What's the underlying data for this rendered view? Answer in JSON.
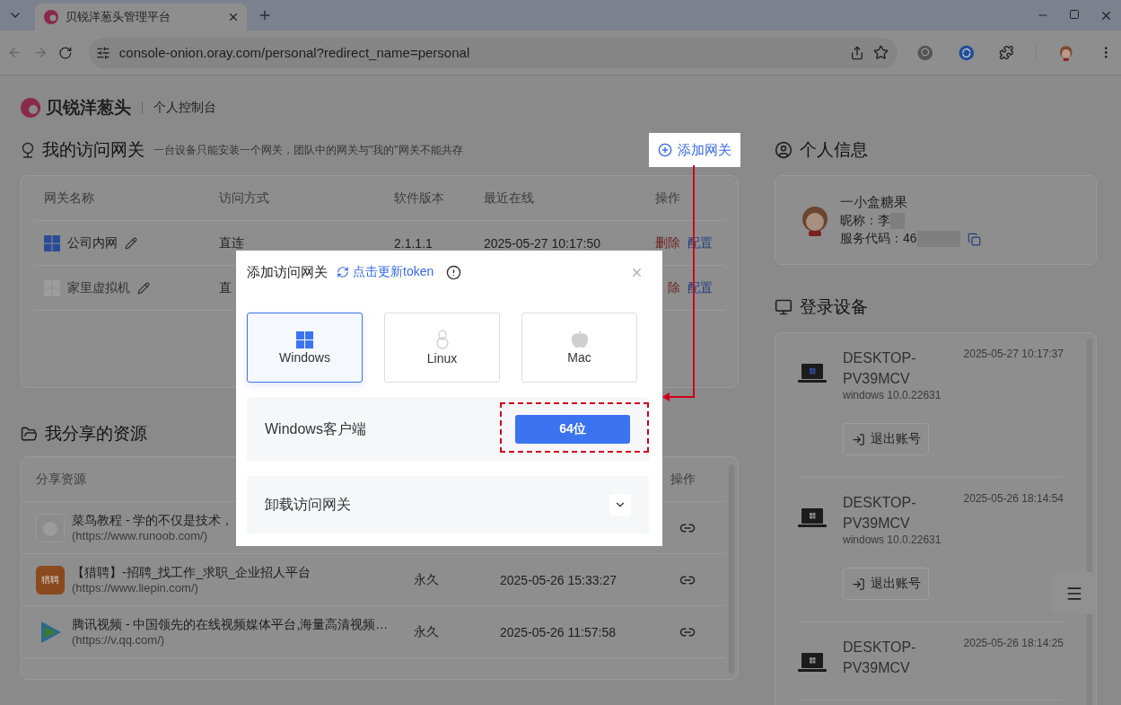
{
  "browser": {
    "tab_title": "贝锐洋葱头管理平台",
    "url": "console-onion.oray.com/personal?redirect_name=personal"
  },
  "header": {
    "brand": "贝锐洋葱头",
    "subtitle": "个人控制台"
  },
  "gateways": {
    "title": "我的访问网关",
    "hint": "一台设备只能安装一个网关，团队中的网关与\"我的\"网关不能共存",
    "add_button": "添加网关",
    "columns": [
      "网关名称",
      "访问方式",
      "软件版本",
      "最近在线",
      "操作"
    ],
    "rows": [
      {
        "name": "公司内网",
        "online": true,
        "access": "直连",
        "version": "2.1.1.1",
        "last_online": "2025-05-27 10:17:50",
        "delete": "删除",
        "configure": "配置"
      },
      {
        "name": "家里虚拟机",
        "online": false,
        "access": "直",
        "delete": "除",
        "configure": "配置"
      }
    ]
  },
  "shares": {
    "title": "我分享的资源",
    "columns": [
      "分享资源",
      "操作"
    ],
    "rows": [
      {
        "kind": "runoob",
        "title": "菜鸟教程 - 学的不仅是技术，",
        "url": "(https://www.runoob.com/)"
      },
      {
        "kind": "liepin",
        "icon_text": "猎聘",
        "title": "【猎聘】-招聘_找工作_求职_企业招人平台",
        "url": "(https://www.liepin.com/)",
        "validity": "永久",
        "time": "2025-05-26 15:33:27"
      },
      {
        "kind": "video",
        "title": "腾讯视频 - 中国领先的在线视频媒体平台,海量高清视频…",
        "url": "(https://v.qq.com/)",
        "validity": "永久",
        "time": "2025-05-26 11:57:58"
      }
    ]
  },
  "profile": {
    "title": "个人信息",
    "name": "一小盒糖果",
    "nickname": "昵称：李",
    "service_code": "服务代码：46"
  },
  "devices": {
    "title": "登录设备",
    "items": [
      {
        "name": "DESKTOP-PV39MCV",
        "time": "2025-05-27 10:17:37",
        "os": "windows 10.0.22631",
        "logout": "退出账号",
        "current": true
      },
      {
        "name": "DESKTOP-PV39MCV",
        "time": "2025-05-26 18:14:54",
        "os": "windows 10.0.22631",
        "logout": "退出账号",
        "current": false
      },
      {
        "name": "DESKTOP-PV39MCV",
        "time": "2025-05-26 18:14:25",
        "current": false
      }
    ]
  },
  "dialog": {
    "title": "添加访问网关",
    "refresh": "点击更新token",
    "platforms": [
      {
        "kind": "windows",
        "label": "Windows",
        "selected": true
      },
      {
        "kind": "linux",
        "label": "Linux",
        "selected": false
      },
      {
        "kind": "mac",
        "label": "Mac",
        "selected": false
      }
    ],
    "client_label": "Windows客户端",
    "download_button": "64位",
    "uninstall_label": "卸载访问网关"
  }
}
